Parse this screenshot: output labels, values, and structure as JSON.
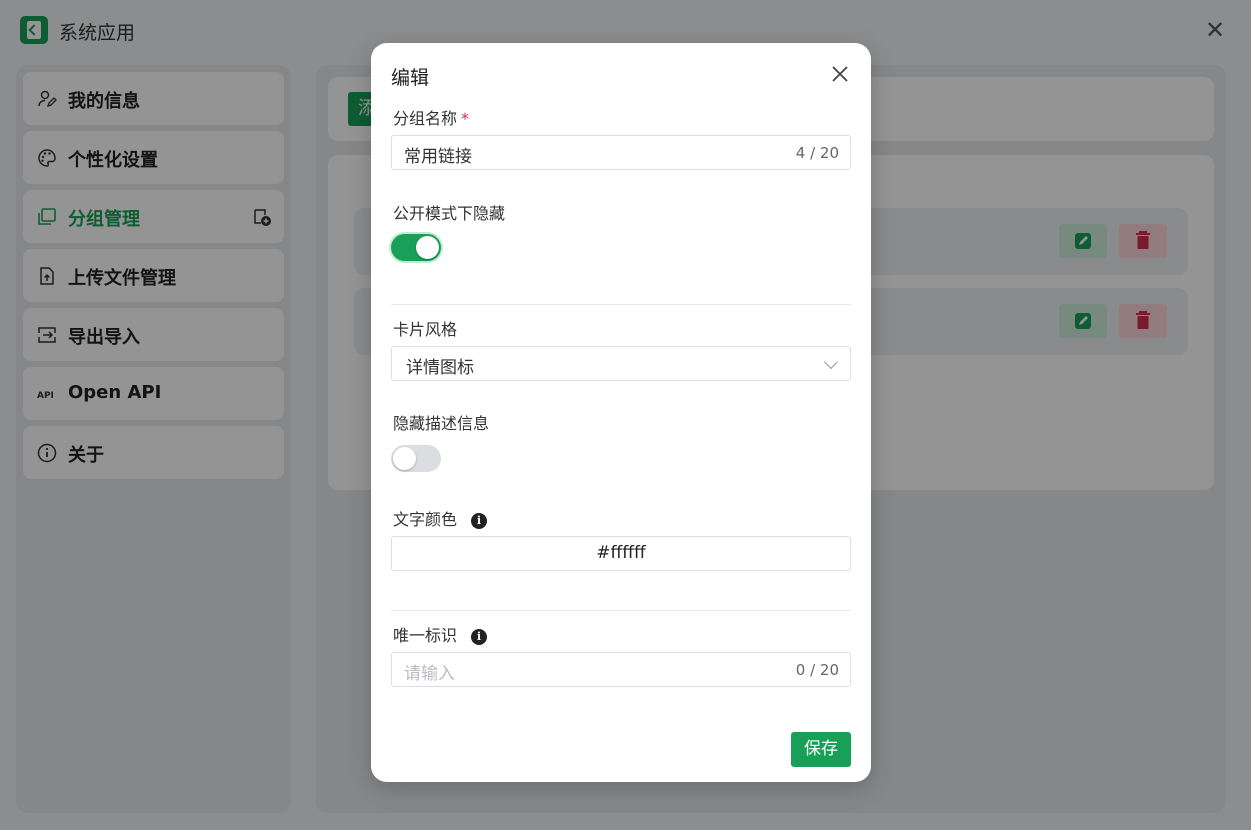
{
  "app": {
    "title": "系统应用",
    "close_icon": "close-icon",
    "logo_icon": "app-logo-icon"
  },
  "sidebar": {
    "items": [
      {
        "label": "我的信息",
        "icon": "user-edit-icon"
      },
      {
        "label": "个性化设置",
        "icon": "palette-icon"
      },
      {
        "label": "分组管理",
        "icon": "group-icon",
        "active": true
      },
      {
        "label": "上传文件管理",
        "icon": "file-upload-icon"
      },
      {
        "label": "导出导入",
        "icon": "import-export-icon"
      },
      {
        "label": "Open API",
        "icon": "api-icon"
      },
      {
        "label": "关于",
        "icon": "info-icon"
      }
    ]
  },
  "content": {
    "add_button_label": "添"
  },
  "modal": {
    "title": "编辑",
    "group_name": {
      "label": "分组名称",
      "required_mark": "*",
      "value": "常用链接",
      "count": "4 / 20"
    },
    "public_hide": {
      "label": "公开模式下隐藏",
      "on": true
    },
    "card_style": {
      "label": "卡片风格",
      "value": "详情图标"
    },
    "hide_desc": {
      "label": "隐藏描述信息",
      "on": false
    },
    "text_color": {
      "label": "文字颜色",
      "value": "#ffffff"
    },
    "unique_id": {
      "label": "唯一标识",
      "placeholder": "请输入",
      "count": "0 / 20"
    },
    "save_label": "保存"
  },
  "colors": {
    "accent": "#18a058",
    "danger": "#d03050",
    "overlay": "rgba(0,0,0,0.42)"
  }
}
